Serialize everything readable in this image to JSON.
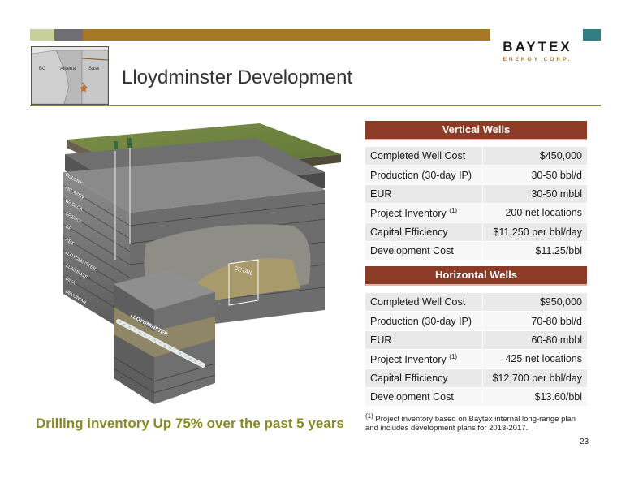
{
  "logo": {
    "name": "BAYTEX",
    "sub": "ENERGY CORP."
  },
  "map": {
    "labels": [
      "BC",
      "Alberta",
      "Sask"
    ]
  },
  "title": "Lloydminster Development",
  "illustration": {
    "formations": [
      "COLONY",
      "McLAREN",
      "WASECA",
      "SPARKY",
      "GP",
      "REX",
      "LLOYDMINSTER",
      "CUMMINGS",
      "DINA",
      "DEVONIAN"
    ],
    "detail_label": "DETAIL",
    "pipe_label": "LLOYDMINSTER"
  },
  "vertical": {
    "header": "Vertical Wells",
    "rows": [
      {
        "label": "Completed Well Cost",
        "value": "$450,000"
      },
      {
        "label": "Production (30-day IP)",
        "value": "30-50 bbl/d"
      },
      {
        "label": "EUR",
        "value": "30-50 mbbl"
      },
      {
        "label": "Project Inventory",
        "sup": "(1)",
        "value": "200 net locations"
      },
      {
        "label": "Capital Efficiency",
        "value": "$11,250 per bbl/day"
      },
      {
        "label": "Development Cost",
        "value": "$11.25/bbl"
      }
    ]
  },
  "horizontal": {
    "header": "Horizontal Wells",
    "rows": [
      {
        "label": "Completed Well Cost",
        "value": "$950,000"
      },
      {
        "label": "Production (30-day IP)",
        "value": "70-80 bbl/d"
      },
      {
        "label": "EUR",
        "value": "60-80 mbbl"
      },
      {
        "label": "Project Inventory",
        "sup": "(1)",
        "value": "425 net locations"
      },
      {
        "label": "Capital Efficiency",
        "value": "$12,700 per bbl/day"
      },
      {
        "label": "Development Cost",
        "value": "$13.60/bbl"
      }
    ]
  },
  "tagline": "Drilling inventory Up 75% over the past 5 years",
  "footnote": {
    "mark": "(1)",
    "text": " Project inventory based on Baytex internal long-range plan and includes development plans for 2013-2017."
  },
  "page_number": "23",
  "colors": {
    "band_olive": "#a8782a",
    "band_teal": "#2f7f83",
    "table_header": "#8c3b26",
    "tagline": "#8a8a22",
    "rule": "#7a8a3a"
  }
}
